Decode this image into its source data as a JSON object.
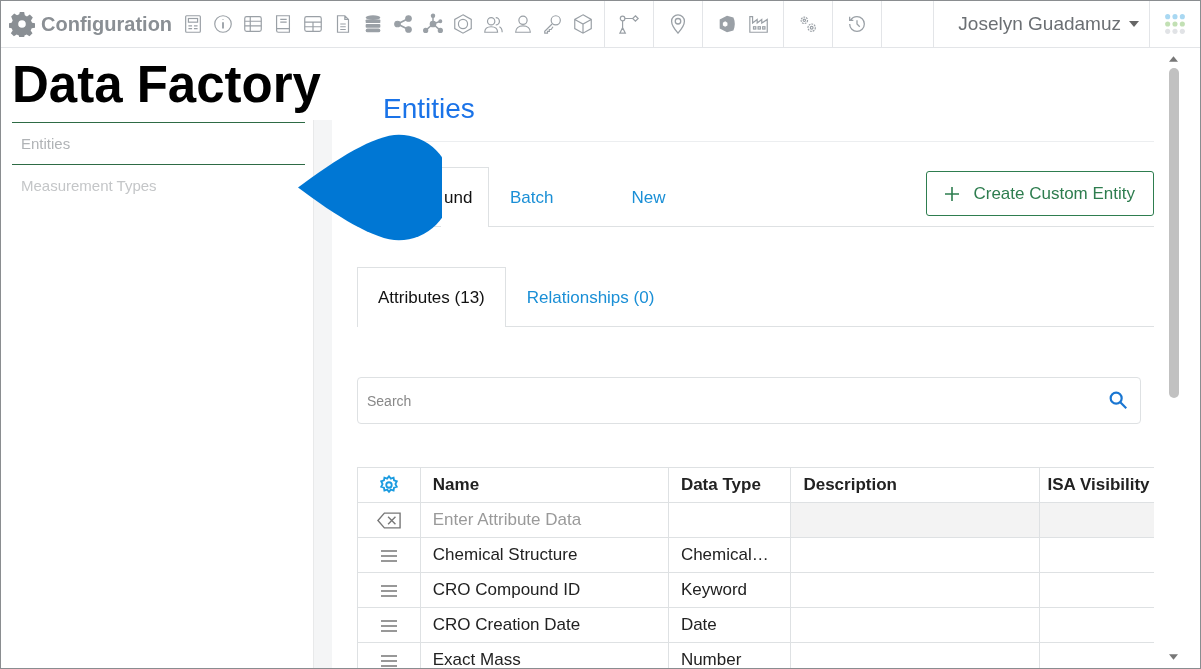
{
  "app_title": "Configuration",
  "user_menu": {
    "name": "Joselyn Guadamuz"
  },
  "sidebar": {
    "title": "Data Factory",
    "items": [
      {
        "label": "Entities",
        "selected": true
      },
      {
        "label": "Measurement Types",
        "selected": false
      }
    ]
  },
  "page_title": "Entities",
  "entity_tabs": [
    {
      "label": "und",
      "selected": true
    },
    {
      "label": "Batch",
      "selected": false
    },
    {
      "label": "New",
      "selected": false
    }
  ],
  "create_button": {
    "label": "Create Custom Entity"
  },
  "sub_tabs": [
    {
      "label": "Attributes (13)",
      "selected": true
    },
    {
      "label": "Relationships (0)",
      "selected": false
    }
  ],
  "search": {
    "placeholder": "Search"
  },
  "table": {
    "columns": [
      "Name",
      "Data Type",
      "Description",
      "ISA Visibility"
    ],
    "entry_placeholder": "Enter Attribute Data",
    "rows": [
      {
        "name": "Chemical Structure",
        "data_type": "Chemical…"
      },
      {
        "name": "CRO Compound ID",
        "data_type": "Keyword"
      },
      {
        "name": "CRO Creation Date",
        "data_type": "Date"
      },
      {
        "name": "Exact Mass",
        "data_type": "Number"
      }
    ]
  }
}
